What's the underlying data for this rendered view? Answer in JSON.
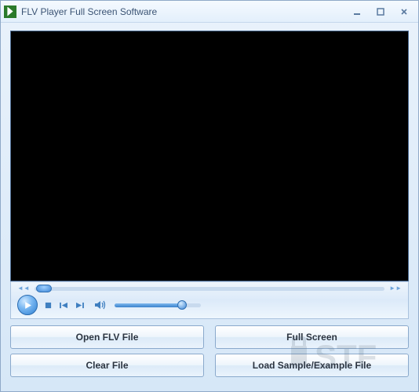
{
  "window": {
    "title": "FLV Player Full Screen Software"
  },
  "buttons": {
    "open": "Open FLV File",
    "fullscreen": "Full Screen",
    "clear": "Clear File",
    "load_sample": "Load Sample/Example File"
  }
}
